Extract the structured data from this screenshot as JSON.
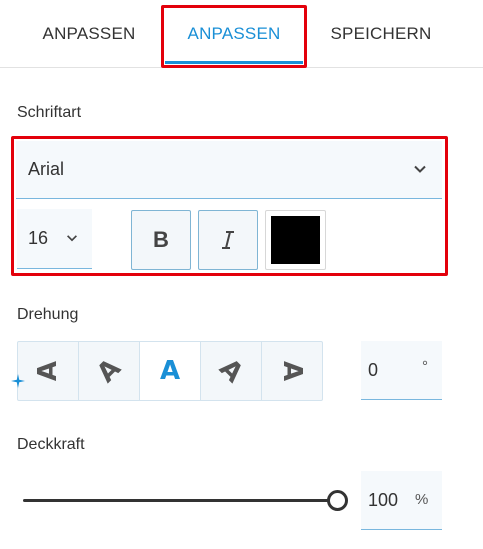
{
  "tabs": [
    {
      "label": "ANPASSEN",
      "active": false
    },
    {
      "label": "ANPASSEN",
      "active": true
    },
    {
      "label": "SPEICHERN",
      "active": false
    }
  ],
  "font": {
    "section_label": "Schriftart",
    "family": "Arial",
    "size": "16",
    "bold_label": "B",
    "italic_icon": "italic-icon",
    "color": "#000000"
  },
  "rotation": {
    "section_label": "Drehung",
    "options": [
      {
        "glyph": "A",
        "rotation_deg": -90
      },
      {
        "glyph": "A",
        "rotation_deg": -45
      },
      {
        "glyph": "A",
        "rotation_deg": 0
      },
      {
        "glyph": "A",
        "rotation_deg": 45
      },
      {
        "glyph": "A",
        "rotation_deg": 90
      }
    ],
    "selected_index": 2,
    "value": "0",
    "unit": "°"
  },
  "opacity": {
    "section_label": "Deckkraft",
    "value": "100",
    "unit": "%",
    "level_percent": 100
  },
  "colors": {
    "accent": "#1a8fd6",
    "highlight": "#e3000b"
  }
}
